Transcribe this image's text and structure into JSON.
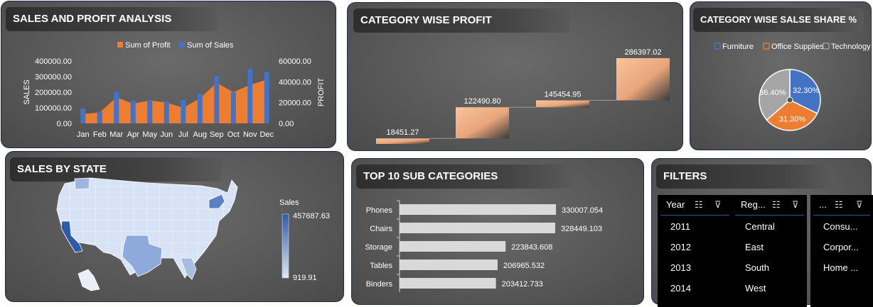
{
  "panels": {
    "sales_profit": {
      "title": "SALES AND PROFIT ANALYSIS"
    },
    "category_profit": {
      "title": "CATEGORY WISE PROFIT"
    },
    "category_share": {
      "title": "CATEGORY WISE SALSE SHARE %"
    },
    "sales_state": {
      "title": "SALES BY STATE"
    },
    "top_sub": {
      "title": "TOP 10 SUB CATEGORIES"
    },
    "filters": {
      "title": "FILTERS"
    }
  },
  "chart_data": [
    {
      "type": "bar",
      "name": "sales-and-profit",
      "categories": [
        "Jan",
        "Feb",
        "Mar",
        "Apr",
        "May",
        "Jun",
        "Jul",
        "Aug",
        "Sep",
        "Oct",
        "Nov",
        "Dec"
      ],
      "series": [
        {
          "name": "Sum of Profit",
          "axis": "secondary",
          "kind": "area",
          "color": "#ed7d31",
          "values": [
            9000,
            10500,
            25000,
            19000,
            22000,
            20000,
            15000,
            24000,
            39000,
            30000,
            37000,
            42000
          ]
        },
        {
          "name": "Sum of Sales",
          "axis": "primary",
          "kind": "bar",
          "color": "#4472c4",
          "values": [
            95000,
            75000,
            200000,
            145000,
            150000,
            140000,
            150000,
            190000,
            305000,
            200000,
            350000,
            330000
          ]
        }
      ],
      "ylabel": "SALES",
      "y2label": "PROFIT",
      "ylim": [
        0,
        400000
      ],
      "y2lim": [
        0,
        60000
      ],
      "yticks": [
        "0.00",
        "100000.00",
        "200000.00",
        "300000.00",
        "400000.00"
      ],
      "y2ticks": [
        "0.00",
        "20000.00",
        "40000.00",
        "60000.00"
      ],
      "legend": "top"
    },
    {
      "type": "bar",
      "name": "category-wise-profit",
      "style": "waterfall",
      "values": [
        18451.27,
        122490.8,
        145454.95,
        286397.02
      ],
      "labels": [
        "18451.27",
        "122490.80",
        "145454.95",
        "286397.02"
      ],
      "color": "#f4b183"
    },
    {
      "type": "pie",
      "name": "category-sales-share",
      "labels": [
        "Furniture",
        "Office Supplies",
        "Technology"
      ],
      "values": [
        32.3,
        31.3,
        36.4
      ],
      "value_labels": [
        "32.30%",
        "31.30%",
        "36.40%"
      ],
      "colors": [
        "#4472c4",
        "#ed7d31",
        "#a5a5a5"
      ],
      "legend": "top"
    },
    {
      "type": "bar",
      "name": "top-10-sub-categories",
      "orientation": "horizontal",
      "categories": [
        "Phones",
        "Chairs",
        "Storage",
        "Tables",
        "Binders"
      ],
      "values": [
        330007.054,
        328449.103,
        223843.608,
        206965.532,
        203412.733
      ],
      "labels": [
        "330007.054",
        "328449.103",
        "223843.608",
        "206965.532",
        "203412.733"
      ],
      "xlim": [
        0,
        480000
      ],
      "color": "#d9d9d9"
    },
    {
      "type": "heatmap",
      "name": "sales-by-state",
      "legend_title": "Sales",
      "max_label": "457687.63",
      "min_label": "919.91",
      "colors": [
        "#dfe7f7",
        "#2f5aa8"
      ]
    }
  ],
  "filters": {
    "slicers": [
      {
        "title": "Year",
        "items": [
          "2011",
          "2012",
          "2013",
          "2014"
        ]
      },
      {
        "title": "Reg...",
        "items": [
          "Central",
          "East",
          "South",
          "West"
        ]
      },
      {
        "title": "...",
        "items": [
          "Consu...",
          "Corpor...",
          "Home ..."
        ]
      }
    ],
    "icons": [
      "multi-select-icon",
      "clear-filter-icon"
    ]
  }
}
